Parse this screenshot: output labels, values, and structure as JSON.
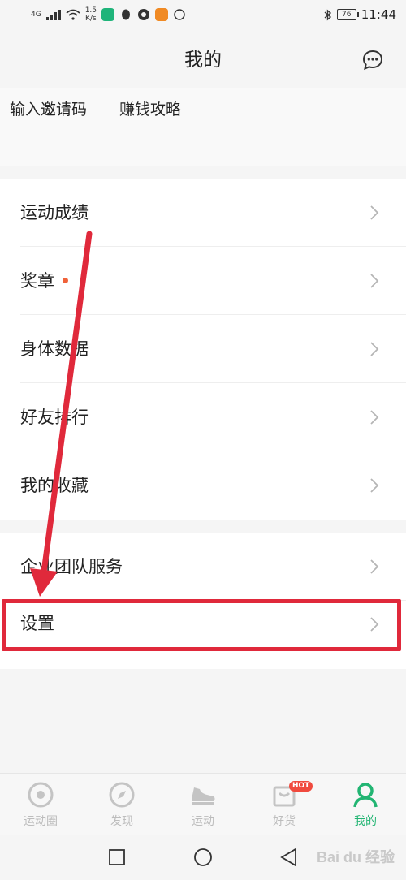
{
  "status_bar": {
    "network": "4G",
    "speed_value": "1.5",
    "speed_unit": "K/s",
    "battery": "76",
    "time": "11:44"
  },
  "header": {
    "title": "我的"
  },
  "invite": {
    "invite_code": "输入邀请码",
    "earn_guide": "赚钱攻略"
  },
  "menu": {
    "group1": [
      {
        "label": "运动成绩"
      },
      {
        "label": "奖章"
      },
      {
        "label": "身体数据"
      },
      {
        "label": "好友排行"
      },
      {
        "label": "我的收藏"
      }
    ],
    "group2": [
      {
        "label": "企业团队服务"
      },
      {
        "label": "设置"
      }
    ]
  },
  "bottom_nav": {
    "items": [
      {
        "label": "运动圈",
        "icon": "circle-target-icon"
      },
      {
        "label": "发现",
        "icon": "compass-icon"
      },
      {
        "label": "运动",
        "icon": "sneaker-icon"
      },
      {
        "label": "好货",
        "icon": "shopping-bag-icon"
      },
      {
        "label": "我的",
        "icon": "person-icon"
      }
    ],
    "active_index": 4,
    "hot_badge": "HOT"
  },
  "watermark": "Bai du 经验",
  "colors": {
    "accent": "#22b573",
    "annotation": "#e0293b",
    "dot": "#f0623a"
  }
}
